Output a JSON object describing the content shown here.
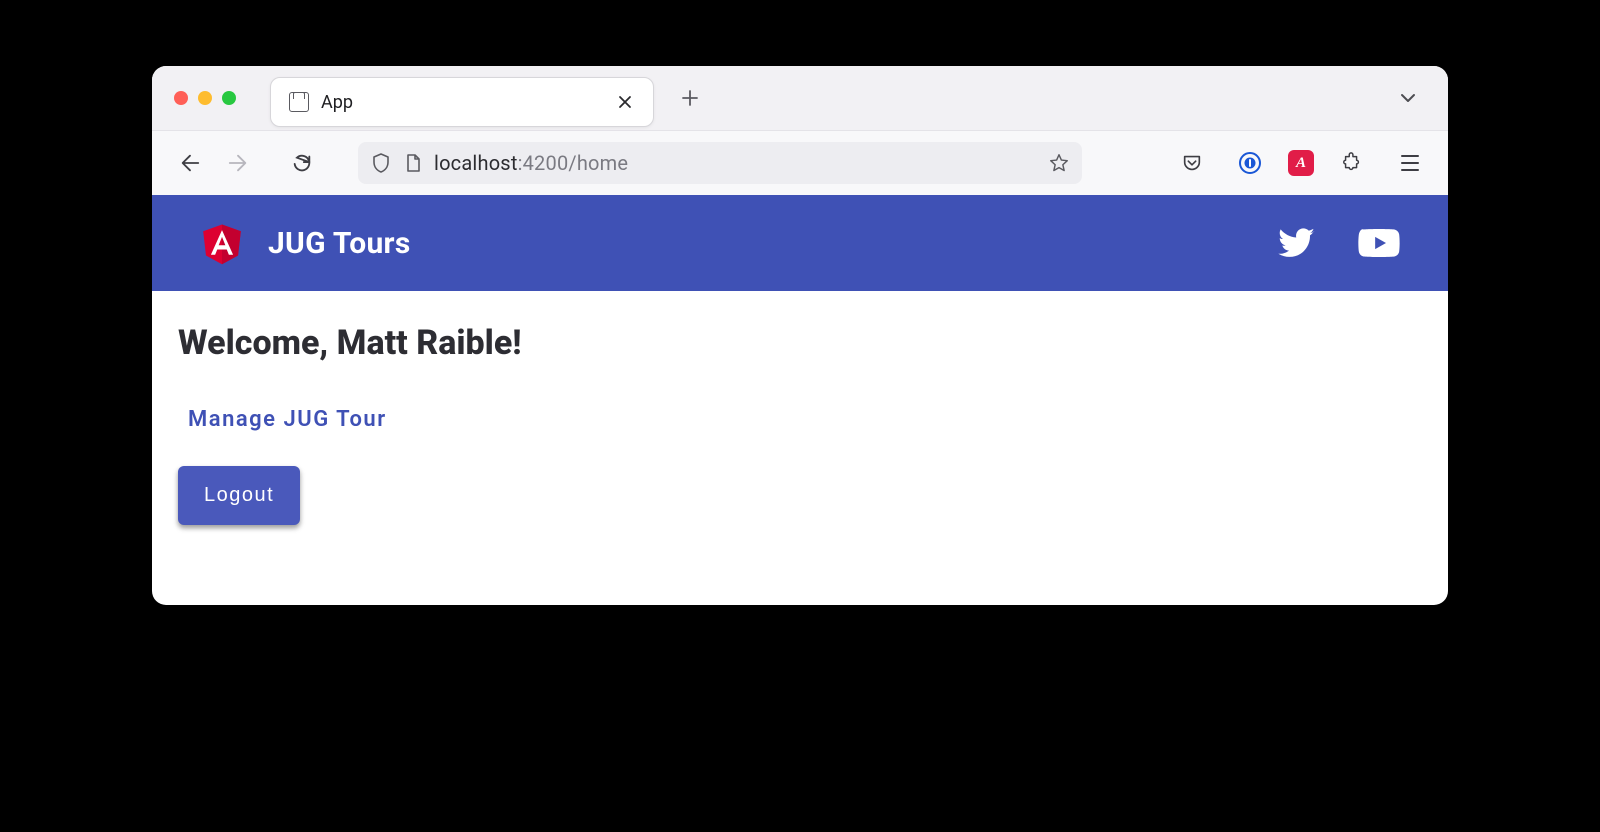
{
  "browser": {
    "tab_title": "App",
    "url_host": "localhost",
    "url_rest": ":4200/home"
  },
  "header": {
    "title": "JUG Tours"
  },
  "main": {
    "welcome": "Welcome, Matt Raible!",
    "manage_link": "Manage JUG Tour",
    "logout_label": "Logout"
  },
  "colors": {
    "primary": "#3f51b5"
  }
}
